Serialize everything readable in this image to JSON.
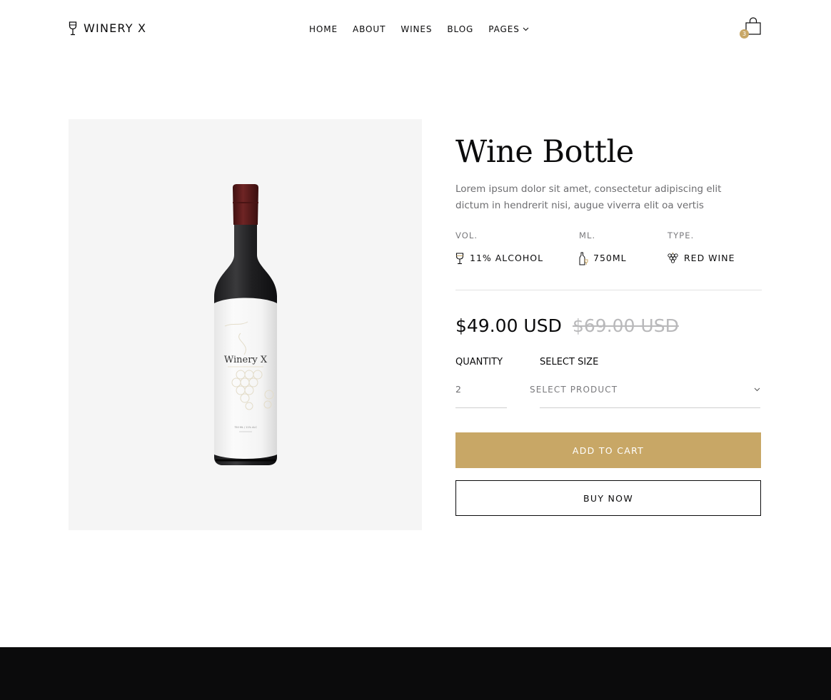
{
  "header": {
    "logo_text": "WINERY X",
    "nav": [
      {
        "label": "HOME"
      },
      {
        "label": "ABOUT"
      },
      {
        "label": "WINES"
      },
      {
        "label": "BLOG"
      },
      {
        "label": "PAGES"
      }
    ],
    "cart_count": "3"
  },
  "product": {
    "image_label": "Winery X",
    "image_sub_label": "750 ML / 11% ALC",
    "title": "Wine Bottle",
    "description": "Lorem ipsum dolor sit amet, consectetur adipiscing elit dictum in hendrerit nisi, augue viverra elit oa vertis",
    "specs": [
      {
        "label": "VOL.",
        "value": "11% ALCOHOL",
        "icon": "wine-glass-icon"
      },
      {
        "label": "ML.",
        "value": "750ML",
        "icon": "bottle-icon"
      },
      {
        "label": "TYPE.",
        "value": "RED WINE",
        "icon": "grapes-icon"
      }
    ],
    "price": "$49.00 USD",
    "old_price": "$69.00 USD",
    "quantity_label": "QUANTITY",
    "quantity_value": "2",
    "size_label": "SELECT SIZE",
    "size_selected": "SELECT PRODUCT",
    "add_to_cart": "ADD TO CART",
    "buy_now": "BUY NOW"
  },
  "colors": {
    "accent": "#c8a766",
    "text": "#0b0b0c",
    "muted": "#6d6d70",
    "panel_bg": "#f5f5f5",
    "footer_bg": "#0b0b0c",
    "bottle_cap": "#5a1a1a"
  }
}
